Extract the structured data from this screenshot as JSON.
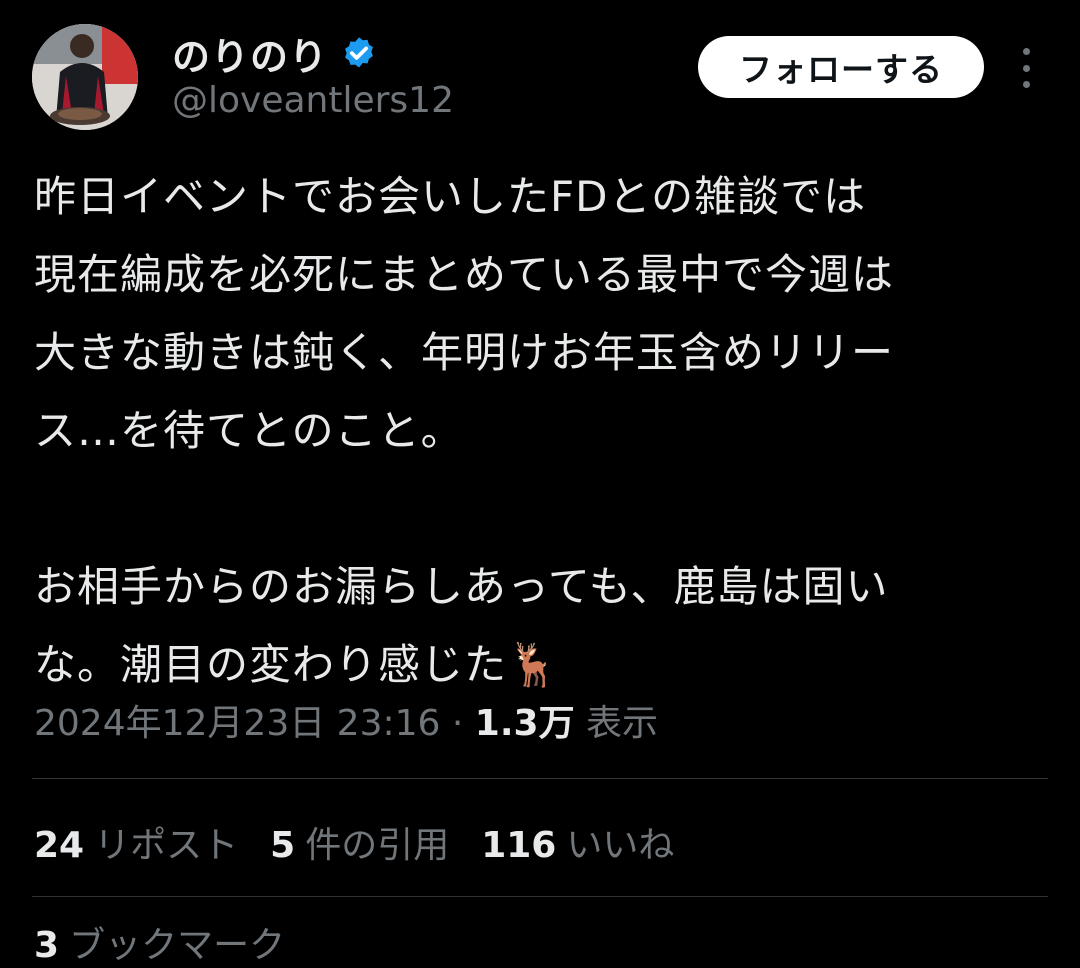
{
  "author": {
    "name": "のりのり",
    "handle": "@loveantlers12",
    "verified_color": "#1d9bf0"
  },
  "follow_button": {
    "label": "フォローする"
  },
  "more_menu": {
    "icon": "more-vertical-icon"
  },
  "tweet": {
    "text": "昨日イベントでお会いしたFDとの雑談では\n現在編成を必死にまとめている最中で今週は\n大きな動きは鈍く、年明けお年玉含めリリー\nス…を待てとのこと。\n\nお相手からのお漏らしあっても、鹿島は固い\nな。潮目の変わり感じた🦌",
    "timestamp": "2024年12月23日 23:16",
    "separator": "·",
    "views_count": "1.3万",
    "views_label": "表示"
  },
  "stats": {
    "reposts": {
      "count": "24",
      "label": "リポスト"
    },
    "quotes": {
      "count": "5",
      "label": "件の引用"
    },
    "likes": {
      "count": "116",
      "label": "いいね"
    },
    "bookmarks": {
      "count": "3",
      "label": "ブックマーク"
    }
  },
  "colors": {
    "background": "#000000",
    "primary_text": "#e7e9ea",
    "secondary_text": "#71767b",
    "divider": "#2f3336",
    "follow_bg": "#ffffff"
  }
}
